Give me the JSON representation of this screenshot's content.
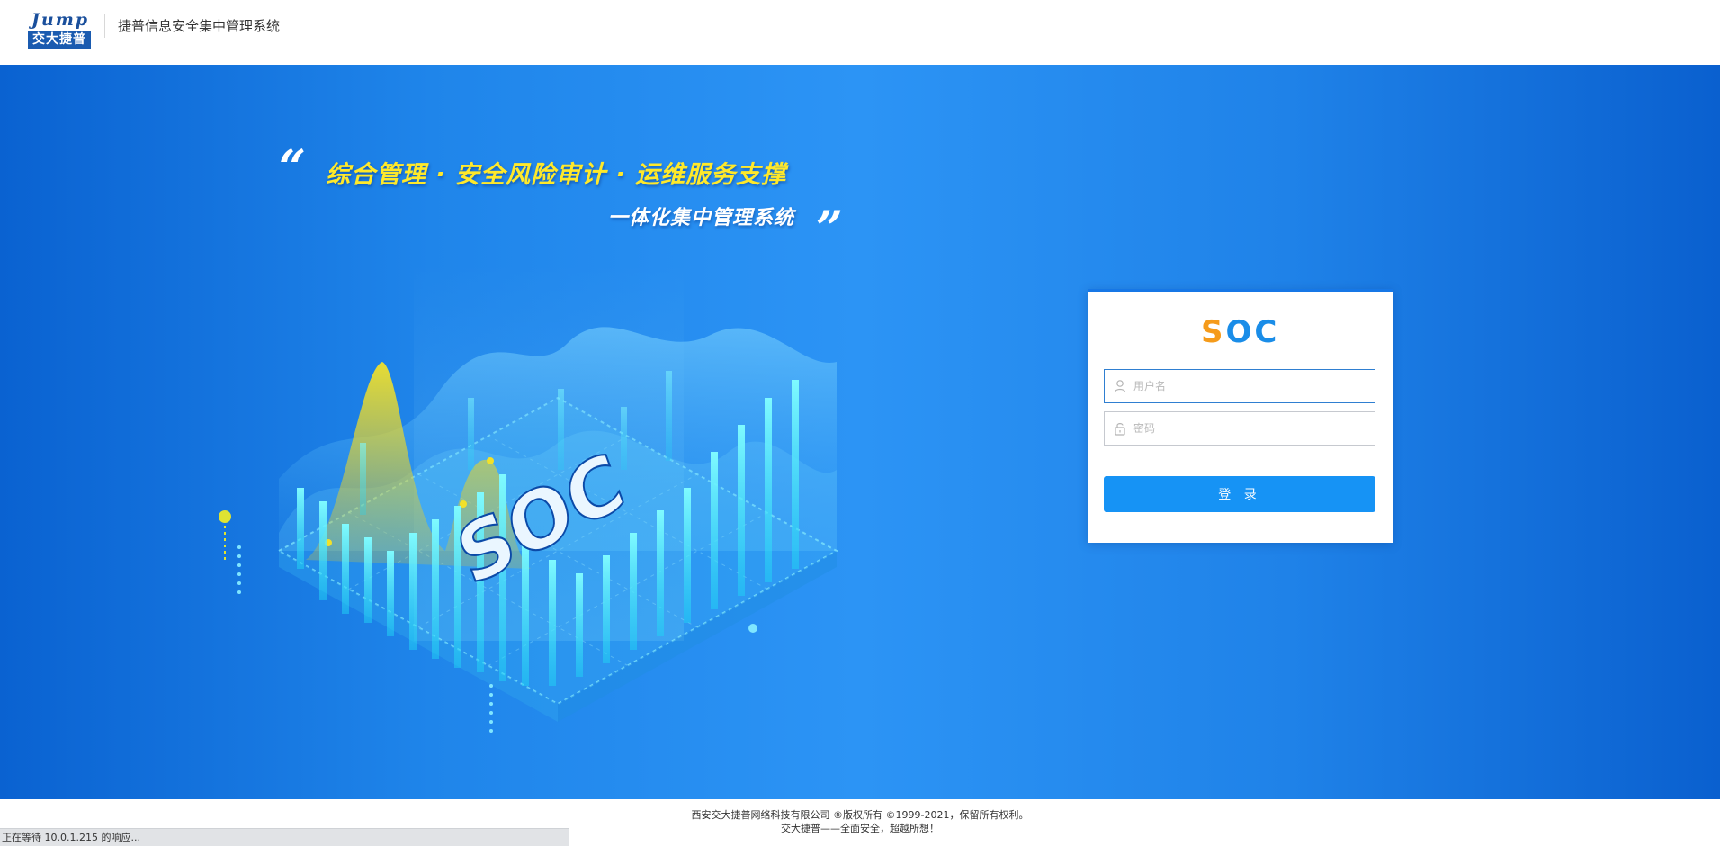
{
  "header": {
    "logo_en": "Jump",
    "logo_cn": "交大捷普",
    "title": "捷普信息安全集中管理系统"
  },
  "hero": {
    "quote_open": "“",
    "quote_close": "”",
    "slogan_line1": "综合管理 · 安全风险审计 · 运维服务支撑",
    "slogan_line2": "一体化集中管理系统",
    "illustration_label": "SOC"
  },
  "login": {
    "logo_s": "S",
    "logo_oc": "OC",
    "username_placeholder": "用户名",
    "password_placeholder": "密码",
    "username_icon": "user-icon",
    "password_icon": "lock-icon",
    "submit_label": "登 录"
  },
  "footer": {
    "line1": "西安交大捷普网络科技有限公司 ®版权所有 ©1999-2021，保留所有权利。",
    "line2": "交大捷普——全面安全，超越所想！"
  },
  "status": {
    "text": "正在等待 10.0.1.215 的响应..."
  },
  "colors": {
    "brand_blue": "#1a5bb0",
    "accent_orange": "#f59b1b",
    "button_blue": "#1693f5",
    "slogan_yellow": "#ffe92a"
  }
}
